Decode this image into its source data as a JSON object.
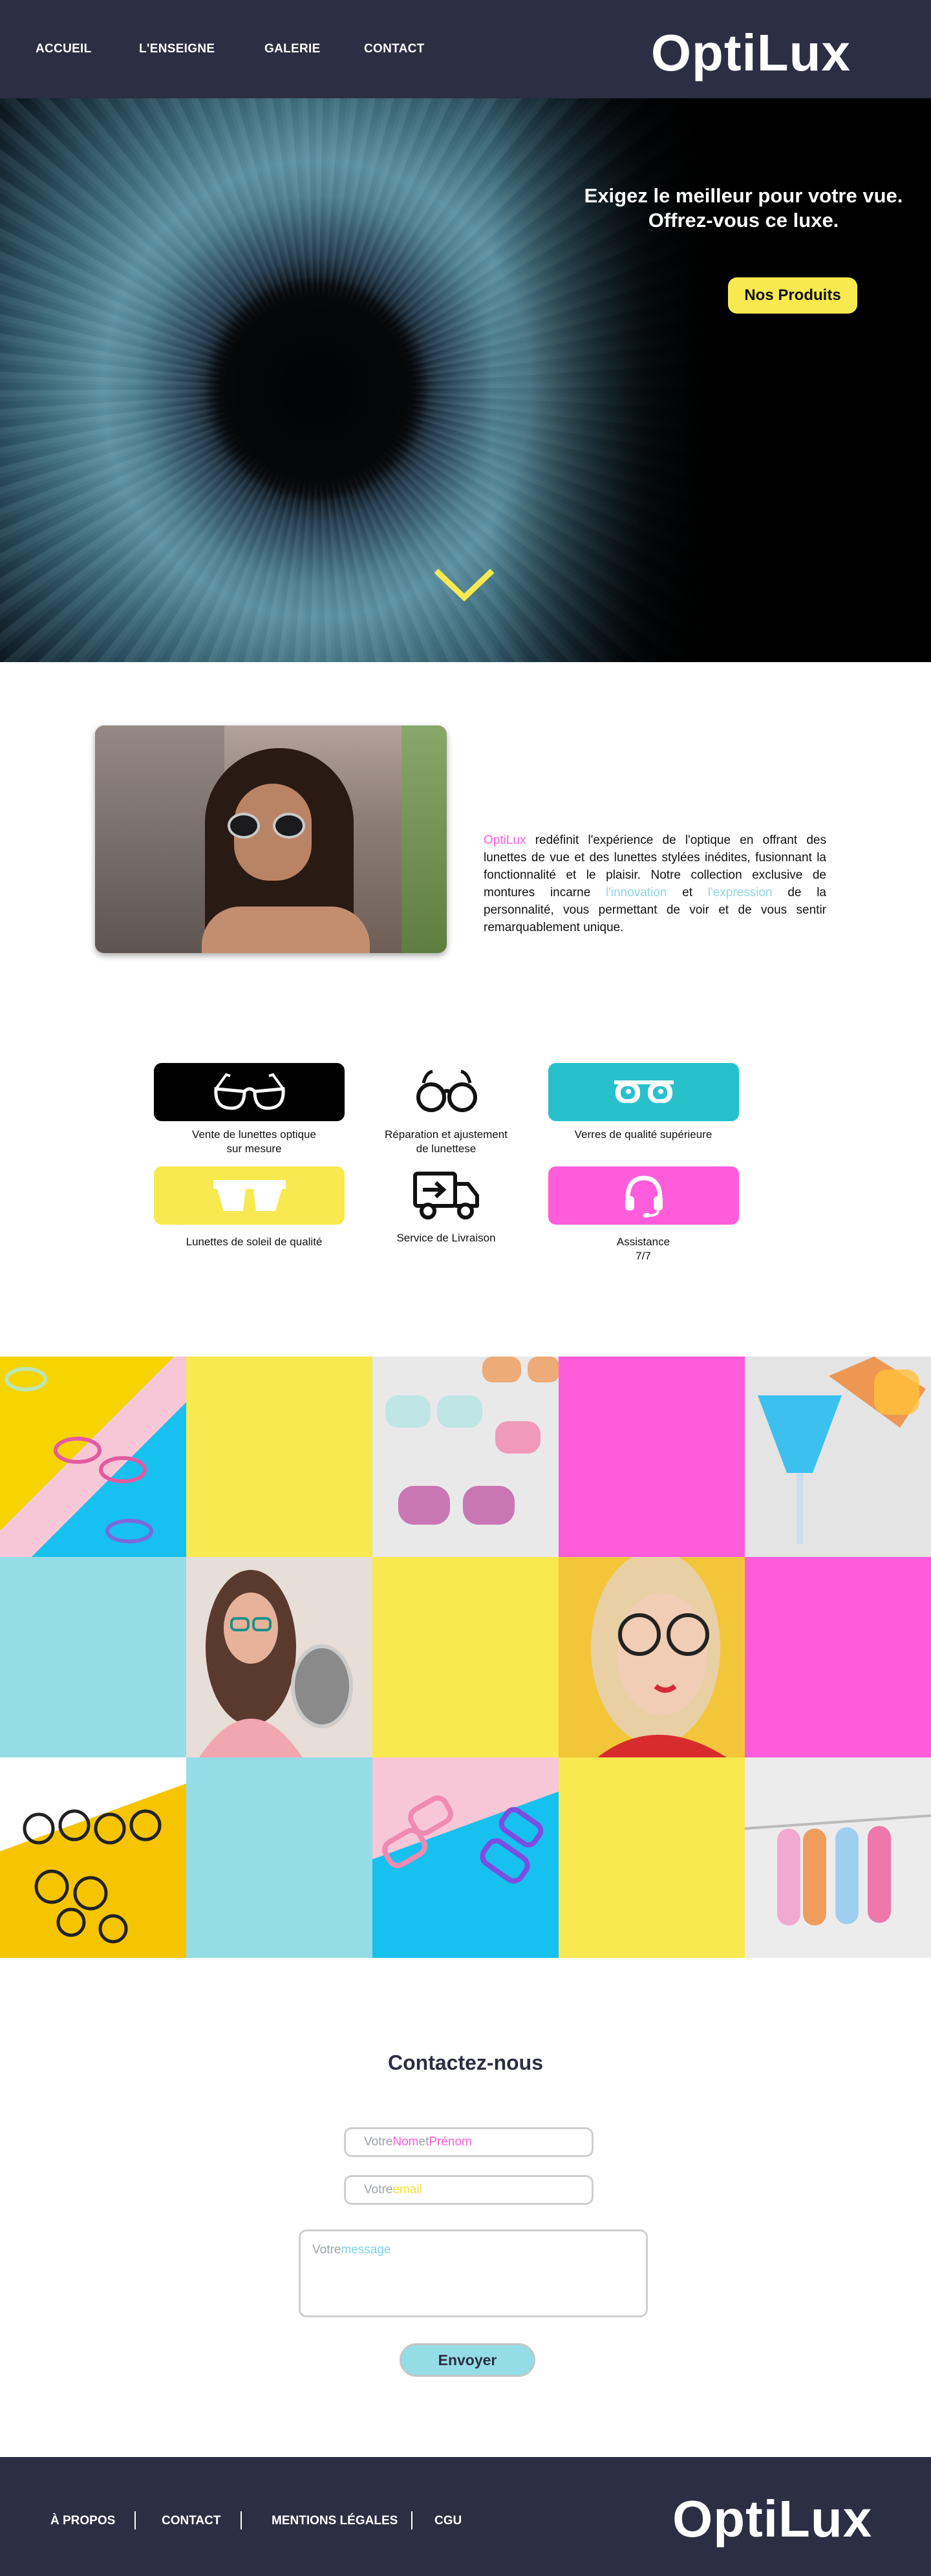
{
  "header": {
    "nav": [
      "ACCUEIL",
      "L'ENSEIGNE",
      "GALERIE",
      "CONTACT"
    ],
    "logo": "OptiLux"
  },
  "hero": {
    "line1": "Exigez le meilleur pour votre vue.",
    "line2": "Offrez-vous ce luxe.",
    "button": "Nos Produits"
  },
  "about": {
    "brand": "OptiLux",
    "text_a": " redéfinit l'expérience de l'optique en offrant des lunettes de vue et des lunettes stylées inédites, fusionnant la fonctionnalité et le plaisir. Notre collection exclusive de montures incarne ",
    "word_innovation": "l'innovation",
    "text_b": " et ",
    "word_expression": "l'expression",
    "text_c": " de la personnalité, vous permettant de voir et de vous sentir remarquablement unique."
  },
  "services": [
    {
      "label_l1": "Vente de lunettes optique",
      "label_l2": "sur mesure",
      "icon": "eyeglasses-icon",
      "bg": "#000000"
    },
    {
      "label_l1": "Réparation et ajustement",
      "label_l2": "de lunettese",
      "icon": "round-glasses-icon",
      "bg": ""
    },
    {
      "label_l1": "Verres de qualité supérieure",
      "label_l2": "",
      "icon": "glasses-lens-icon",
      "bg": "#27c1cc"
    },
    {
      "label_l1": "Lunettes de soleil de qualité",
      "label_l2": "",
      "icon": "sunglasses-icon",
      "bg": "#f7e94f"
    },
    {
      "label_l1": "Service de Livraison",
      "label_l2": "",
      "icon": "delivery-truck-icon",
      "bg": ""
    },
    {
      "label_l1": "Assistance",
      "label_l2": "7/7",
      "icon": "headset-icon",
      "bg": "#ff5cdc"
    }
  ],
  "contact": {
    "title": "Contactez-nous",
    "name_ph": {
      "a": "Votre ",
      "b": "Nom",
      "c": " et ",
      "d": "Prénom"
    },
    "email_ph": {
      "a": "Votre ",
      "b": "email"
    },
    "msg_ph": {
      "a": "Votre ",
      "b": "message"
    },
    "send": "Envoyer"
  },
  "footer": {
    "links": [
      "À PROPOS",
      "CONTACT",
      "MENTIONS LÉGALES",
      "CGU"
    ],
    "logo": "OptiLux"
  },
  "colors": {
    "navy": "#2c2e43",
    "yellow": "#f7e94f",
    "pink": "#ff5cdc",
    "cyan": "#27c1cc",
    "light_cyan": "#94dde6"
  }
}
